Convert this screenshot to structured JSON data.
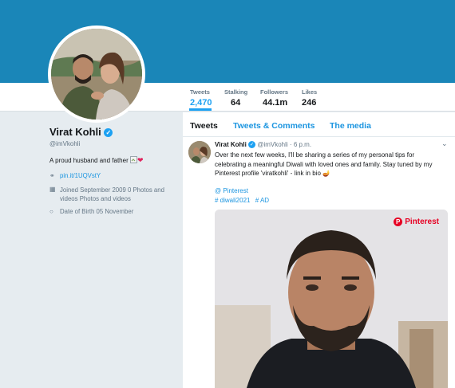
{
  "profile": {
    "name": "Virat Kohli",
    "handle": "@imVkohli",
    "bio": "A proud husband and father",
    "website": "pin.it/1UQVstY",
    "joined": "Joined September 2009 0 Photos and videos Photos and videos",
    "birth": "Date of Birth 05 November"
  },
  "stats": [
    {
      "label": "Tweets",
      "value": "2,470"
    },
    {
      "label": "Stalking",
      "value": "64"
    },
    {
      "label": "Followers",
      "value": "44.1m"
    },
    {
      "label": "Likes",
      "value": "246"
    }
  ],
  "tabs": [
    "Tweets",
    "Tweets & Comments",
    "The media"
  ],
  "tweet": {
    "name": "Virat Kohli",
    "handle": "@imVkohli",
    "time": "6 p.m.",
    "text": "Over the next few weeks, I'll be sharing a series of my personal tips for celebrating a meaningful Diwali with loved ones and family. Stay tuned by my Pinterest profile 'viratkohli' - link in bio",
    "link": "@ Pinterest",
    "tags": [
      "# diwali2021",
      "# AD"
    ],
    "media_badge": "Pinterest"
  },
  "colors": {
    "banner": "#1a86b8",
    "accent": "#1da1f2",
    "link": "#1b95e0",
    "pinterest": "#e60023"
  },
  "icons": {
    "verified": "verified-badge-icon",
    "link": "link-icon",
    "calendar": "calendar-icon",
    "balloon": "balloon-icon",
    "caret": "chevron-down-icon"
  }
}
